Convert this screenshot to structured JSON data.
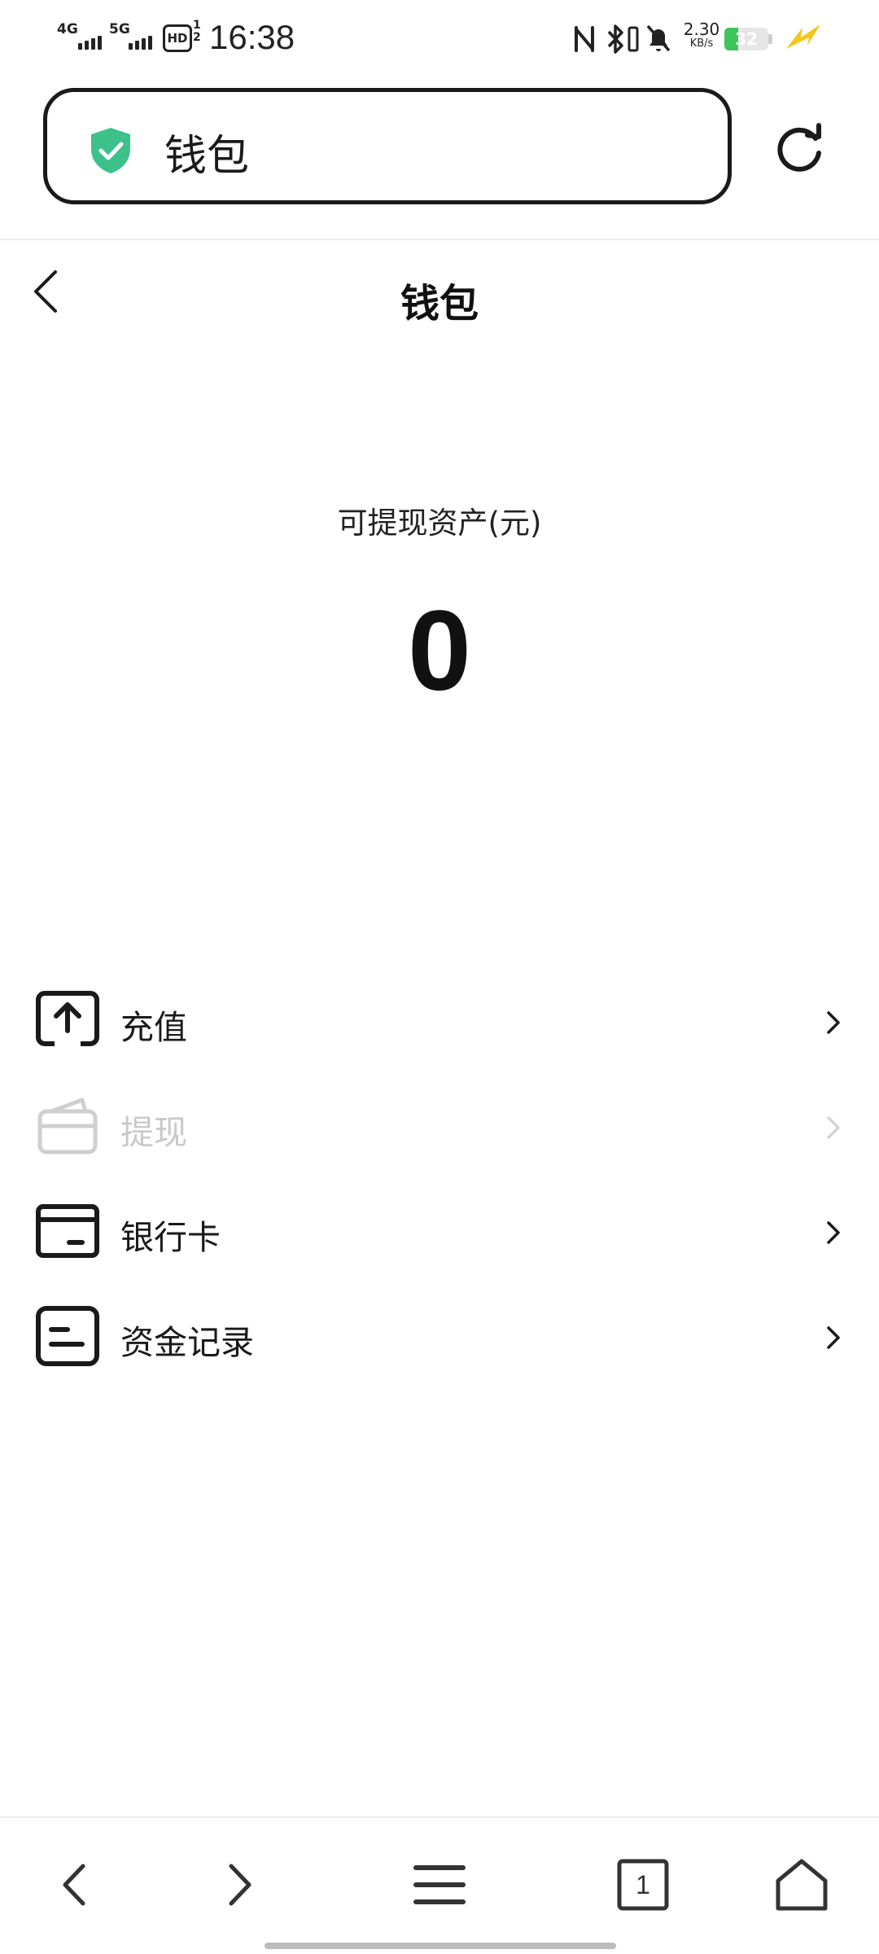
{
  "status_bar": {
    "network_1": "4G",
    "network_2": "5G",
    "hd_label": "HD",
    "hd_sub": "1\n2",
    "time": "16:38",
    "speed_value": "2.30",
    "speed_unit": "KB/s",
    "battery_level": "32",
    "battery_fraction": 0.32,
    "icons": [
      "nfc-icon",
      "bluetooth-icon",
      "vibrate-icon",
      "mute-icon",
      "charging-icon"
    ]
  },
  "browser": {
    "url_text": "钱包",
    "secure_icon": "shield-check-icon",
    "secure_color": "#3cc18a",
    "refresh_icon": "refresh-icon"
  },
  "page": {
    "title": "钱包",
    "back_icon": "chevron-left-icon"
  },
  "balance": {
    "label": "可提现资产(元)",
    "value": "0"
  },
  "menu": {
    "items": [
      {
        "label": "充值",
        "icon": "upload-icon",
        "enabled": true
      },
      {
        "label": "提现",
        "icon": "wallet-icon",
        "enabled": false
      },
      {
        "label": "银行卡",
        "icon": "bank-card-icon",
        "enabled": true
      },
      {
        "label": "资金记录",
        "icon": "record-icon",
        "enabled": true
      }
    ]
  },
  "bottom_nav": {
    "tab_count": "1",
    "icons": [
      "back-icon",
      "forward-icon",
      "menu-icon",
      "tabs-icon",
      "home-icon"
    ]
  }
}
